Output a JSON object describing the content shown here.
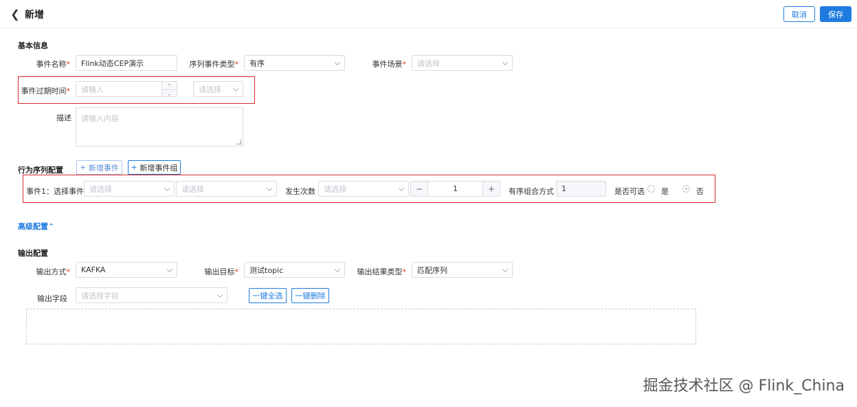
{
  "header": {
    "title": "新增",
    "cancel_label": "取消",
    "save_label": "保存"
  },
  "basic": {
    "section_title": "基本信息",
    "event_name_label": "事件名称",
    "event_name_value": "Flink动态CEP演示",
    "seq_type_label": "序列事件类型",
    "seq_type_value": "有序",
    "scene_label": "事件场景",
    "scene_placeholder": "请选择",
    "expire_label": "事件过期时间",
    "expire_placeholder": "请输入",
    "expire_unit_placeholder": "请选择",
    "desc_label": "描述",
    "desc_placeholder": "请输入内容"
  },
  "behavior": {
    "section_title": "行为序列配置",
    "add_event_label": "新增事件",
    "add_group_label": "新增事件组",
    "row_label": "事件1：选择事件",
    "event_select_placeholder": "请选择",
    "attr_select_placeholder": "请选择",
    "occur_label": "发生次数",
    "occur_select_placeholder": "请选择",
    "count_value": "1",
    "combo_label": "有序组合方式",
    "combo_value": "1",
    "optional_label": "是否可选",
    "yes_label": "是",
    "no_label": "否",
    "selected": "否"
  },
  "advanced": {
    "label": "高级配置"
  },
  "output": {
    "section_title": "输出配置",
    "method_label": "输出方式",
    "method_value": "KAFKA",
    "target_label": "输出目标",
    "target_value": "测试topic",
    "result_type_label": "输出结果类型",
    "result_type_value": "匹配序列",
    "fields_label": "输出字段",
    "fields_placeholder": "请选择字段",
    "select_all_label": "一键全选",
    "delete_all_label": "一键删除"
  },
  "watermark": "掘金技术社区 @ Flink_China",
  "colors": {
    "primary": "#1f7be0",
    "required": "#e0352e",
    "highlight": "#d8262a"
  }
}
